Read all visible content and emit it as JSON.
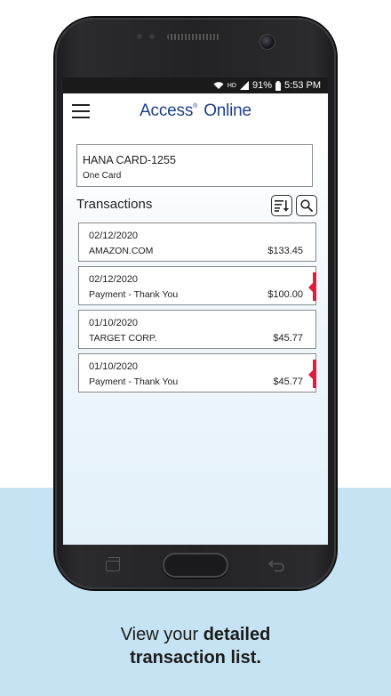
{
  "status_bar": {
    "hd": "HD",
    "battery": "91%",
    "time": "5:53 PM"
  },
  "header": {
    "brand_main": "Access",
    "brand_reg": "®",
    "brand_second": "Online"
  },
  "card": {
    "name": "HANA CARD-1255",
    "type": "One Card"
  },
  "transactions": {
    "title": "Transactions",
    "items": [
      {
        "date": "02/12/2020",
        "description": "AMAZON.COM",
        "amount": "$133.45",
        "flagged": false
      },
      {
        "date": "02/12/2020",
        "description": "Payment - Thank You",
        "amount": "$100.00",
        "flagged": true
      },
      {
        "date": "01/10/2020",
        "description": "TARGET CORP.",
        "amount": "$45.77",
        "flagged": false
      },
      {
        "date": "01/10/2020",
        "description": "Payment - Thank You",
        "amount": "$45.77",
        "flagged": true
      }
    ]
  },
  "caption": {
    "line1_plain": "View your ",
    "line1_bold": "detailed",
    "line2_bold": "transaction list."
  },
  "colors": {
    "brand": "#1d3f8a",
    "flag": "#e01d3c",
    "backdrop": "#c5e3f3"
  },
  "icons": [
    "menu-icon",
    "sort-icon",
    "search-icon",
    "wifi-icon",
    "signal-icon",
    "battery-icon"
  ]
}
